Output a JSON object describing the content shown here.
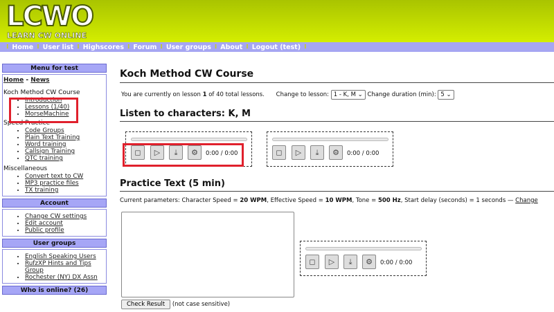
{
  "header": {
    "logo": "LCWO",
    "tagline": "LEARN CW ONLINE"
  },
  "nav": [
    "Home",
    "User list",
    "Highscores",
    "Forum",
    "User groups",
    "About",
    "Logout (test)"
  ],
  "sidebar": {
    "menu_title": "Menu for test",
    "home": "Home",
    "dash": "-",
    "news": "News",
    "koch_title": "Koch Method CW Course",
    "koch": [
      "Introduction",
      "Lessons (1/40)",
      "MorseMachine"
    ],
    "speed_title": "Speed Practice",
    "speed": [
      "Code Groups",
      "Plain Text Training",
      "Word training",
      "Callsign Training",
      "QTC training"
    ],
    "misc_title": "Miscellaneous",
    "misc": [
      "Convert text to CW",
      "MP3 practice files",
      "TX training"
    ],
    "account_title": "Account",
    "account": [
      "Change CW settings",
      "Edit account",
      "Public profile"
    ],
    "groups_title": "User groups",
    "groups": [
      "English Speaking Users",
      "RufzXP Hints and Tips Group",
      "Rochester (NY) DX Assn"
    ],
    "online_title": "Who is online? (26)"
  },
  "main": {
    "title": "Koch Method CW Course",
    "lesson_pre": "You are currently on lesson ",
    "lesson_num": "1",
    "lesson_post": " of 40 total lessons.",
    "change_lesson_label": "Change to lesson:",
    "lesson_value": "1 - K, M",
    "change_duration_label": "Change duration (min):",
    "duration_value": "5",
    "listen_title": "Listen to characters: K, M",
    "player_time": "0:00 / 0:00",
    "practice_title": "Practice Text (5 min)",
    "params_pre": "Current parameters: Character Speed = ",
    "char_speed": "20 WPM",
    "params_2": ", Effective Speed = ",
    "eff_speed": "10 WPM",
    "params_3": ", Tone = ",
    "tone": "500 Hz",
    "params_4": ", Start delay (seconds) = 1 seconds — ",
    "change_link": "Change",
    "check_button": "Check Result",
    "case_note": "(not case sensitive)"
  }
}
